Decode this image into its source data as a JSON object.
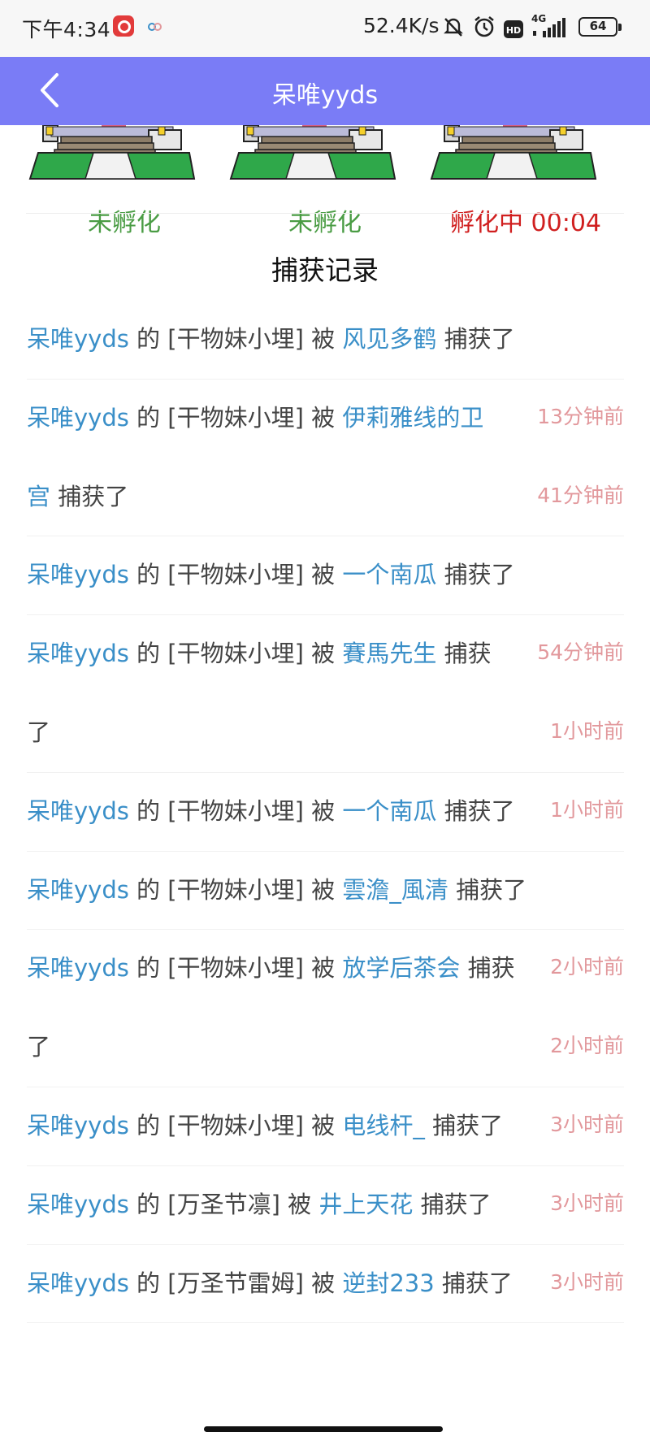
{
  "status_bar": {
    "time": "下午4:34",
    "net_speed": "52.4K/s",
    "network": "4G",
    "battery": "64",
    "icons": [
      "netease-music-icon",
      "cloud-app-icon",
      "mute-bell-icon",
      "alarm-icon",
      "hd-icon",
      "signal-icon",
      "battery-icon"
    ]
  },
  "header": {
    "title": "呆唯yyds",
    "back_icon": "chevron-left-icon",
    "bg_color": "#7a7cf6"
  },
  "eggs": [
    {
      "status": "未孵化",
      "color": "#4a9c44"
    },
    {
      "status": "未孵化",
      "color": "#4a9c44"
    },
    {
      "status": "孵化中 00:04",
      "color": "#d01f1f"
    }
  ],
  "records_title": "捕获记录",
  "records": [
    {
      "owner": "呆唯yyds",
      "of": " 的 ",
      "item": "[干物妹小埋]",
      "by": " 被 ",
      "catcher": "风见多鹤",
      "suffix": " 捕获了",
      "time": ""
    },
    {
      "owner": "呆唯yyds",
      "of": " 的 ",
      "item": "[干物妹小埋]",
      "by": " 被 ",
      "catcher": "伊莉雅线的卫",
      "suffix": "",
      "time": "13分钟前"
    },
    {
      "cont": "宫",
      "suffix": " 捕获了",
      "time": "41分钟前"
    },
    {
      "owner": "呆唯yyds",
      "of": " 的 ",
      "item": "[干物妹小埋]",
      "by": " 被 ",
      "catcher": "一个南瓜",
      "suffix": " 捕获了",
      "time": ""
    },
    {
      "owner": "呆唯yyds",
      "of": " 的 ",
      "item": "[干物妹小埋]",
      "by": " 被 ",
      "catcher": "賽馬先生",
      "suffix": " 捕获",
      "time": "54分钟前"
    },
    {
      "cont": "",
      "suffix": "了",
      "time": "1小时前"
    },
    {
      "owner": "呆唯yyds",
      "of": " 的 ",
      "item": "[干物妹小埋]",
      "by": " 被 ",
      "catcher": "一个南瓜",
      "suffix": " 捕获了",
      "time": "1小时前"
    },
    {
      "owner": "呆唯yyds",
      "of": " 的 ",
      "item": "[干物妹小埋]",
      "by": " 被 ",
      "catcher": "雲澹_風清",
      "suffix": " 捕获了",
      "time": ""
    },
    {
      "owner": "呆唯yyds",
      "of": " 的 ",
      "item": "[干物妹小埋]",
      "by": " 被 ",
      "catcher": "放学后茶会",
      "suffix": " 捕获",
      "time": "2小时前"
    },
    {
      "cont": "",
      "suffix": "了",
      "time": "2小时前"
    },
    {
      "owner": "呆唯yyds",
      "of": " 的 ",
      "item": "[干物妹小埋]",
      "by": " 被 ",
      "catcher": "电线杆_",
      "suffix": " 捕获了",
      "time": "3小时前"
    },
    {
      "owner": "呆唯yyds",
      "of": " 的 ",
      "item": "[万圣节凛]",
      "by": " 被 ",
      "catcher": "井上天花",
      "suffix": " 捕获了",
      "time": "3小时前"
    },
    {
      "owner": "呆唯yyds",
      "of": " 的 ",
      "item": "[万圣节雷姆]",
      "by": " 被 ",
      "catcher": "逆封233",
      "suffix": " 捕获了",
      "time": "3小时前"
    }
  ]
}
